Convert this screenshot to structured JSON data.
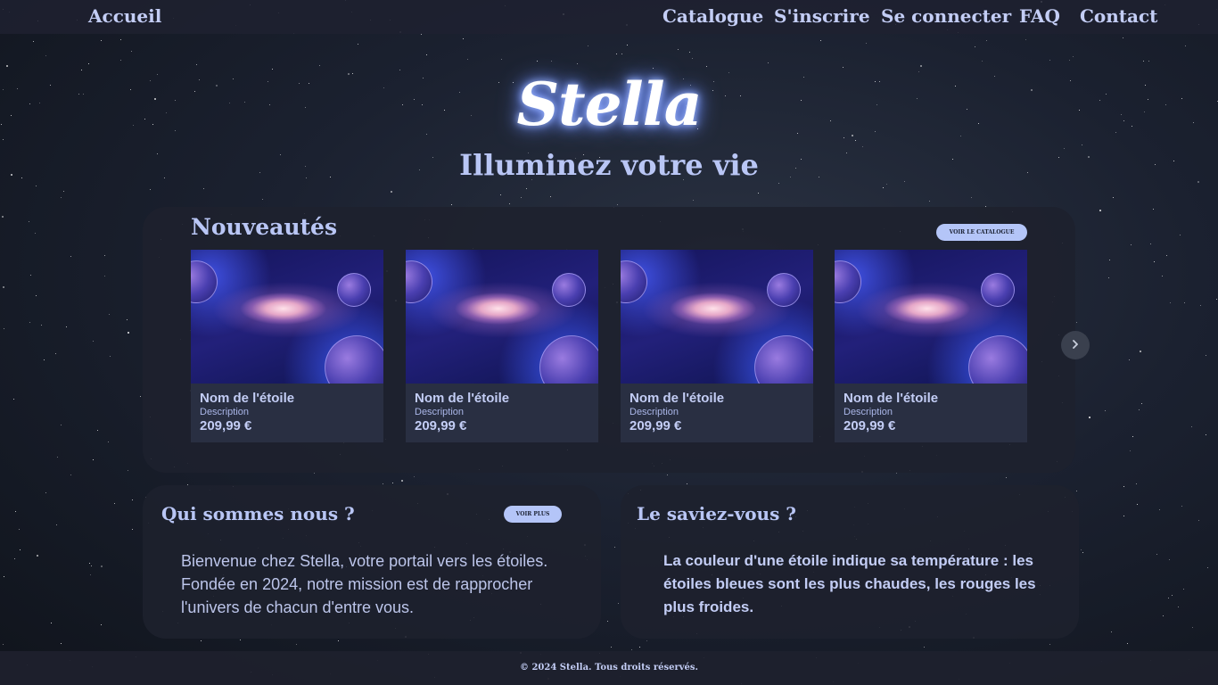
{
  "nav": {
    "home": "Accueil",
    "catalogue": "Catalogue",
    "register": "S'inscrire",
    "login": "Se connecter",
    "faq": "FAQ",
    "contact": "Contact"
  },
  "hero": {
    "logo": "Stella",
    "tagline": "Illuminez votre vie"
  },
  "new_items": {
    "title": "Nouveautés",
    "catalogue_button": "VOIR LE CATALOGUE",
    "cards": [
      {
        "name": "Nom de l'étoile",
        "description": "Description",
        "price": "209,99 €"
      },
      {
        "name": "Nom de l'étoile",
        "description": "Description",
        "price": "209,99 €"
      },
      {
        "name": "Nom de l'étoile",
        "description": "Description",
        "price": "209,99 €"
      },
      {
        "name": "Nom de l'étoile",
        "description": "Description",
        "price": "209,99 €"
      }
    ],
    "next_icon": "chevron-right-icon"
  },
  "about": {
    "title": "Qui sommes nous ?",
    "button": "VOIR PLUS",
    "text": "Bienvenue chez Stella, votre portail vers les étoiles. Fondée en 2024, notre mission est de rapprocher l'univers de chacun d'entre vous."
  },
  "fact": {
    "title": "Le saviez-vous ?",
    "text": "La couleur d'une étoile indique sa température : les étoiles bleues sont les plus chaudes, les rouges les plus froides."
  },
  "footer": {
    "text": "© 2024 Stella. Tous droits réservés."
  },
  "colors": {
    "accent": "#b4c5f8",
    "text": "#c3cdf5",
    "panel": "#1e212e"
  }
}
